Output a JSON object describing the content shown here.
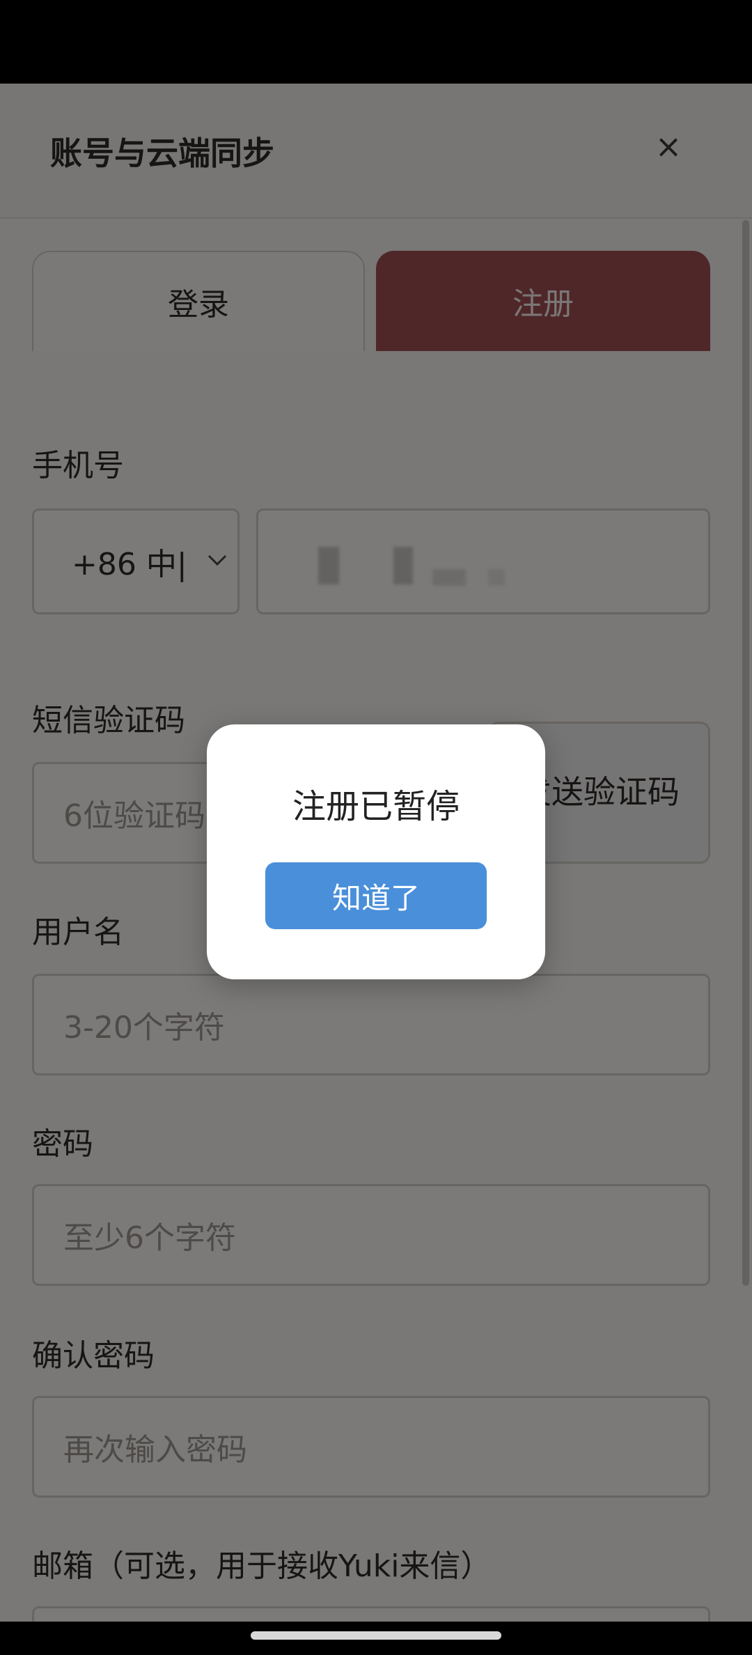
{
  "header": {
    "title": "账号与云端同步",
    "close_label": "×"
  },
  "tabs": [
    {
      "label": "登录"
    },
    {
      "label": "注册"
    }
  ],
  "form": {
    "phone_label": "手机号",
    "country_code": "+86 中|",
    "sms_label": "短信验证码",
    "sms_placeholder": "6位验证码",
    "send_code_label": "发送验证码",
    "username_label": "用户名",
    "username_placeholder": "3-20个字符",
    "password_label": "密码",
    "password_placeholder": "至少6个字符",
    "confirm_label": "确认密码",
    "confirm_placeholder": "再次输入密码",
    "email_label": "邮箱（可选，用于接收Yuki来信）"
  },
  "dialog": {
    "message": "注册已暂停",
    "button": "知道了"
  },
  "colors": {
    "accent_tab": "#9e4f52",
    "dialog_button": "#4a8fda"
  },
  "icons": {
    "close": "close-icon",
    "dropdown": "chevron-down-icon"
  }
}
